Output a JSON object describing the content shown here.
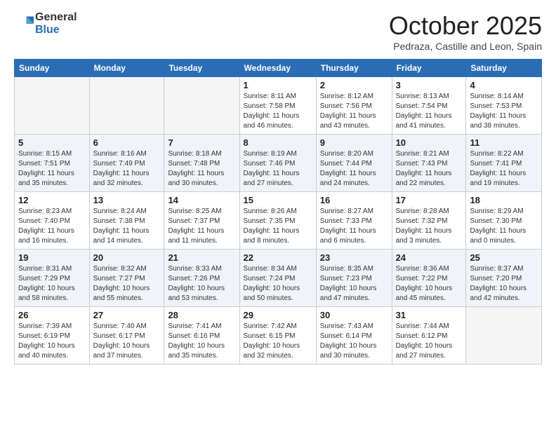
{
  "header": {
    "logo_general": "General",
    "logo_blue": "Blue",
    "month_title": "October 2025",
    "location": "Pedraza, Castille and Leon, Spain"
  },
  "days_of_week": [
    "Sunday",
    "Monday",
    "Tuesday",
    "Wednesday",
    "Thursday",
    "Friday",
    "Saturday"
  ],
  "weeks": [
    [
      {
        "day": "",
        "info": ""
      },
      {
        "day": "",
        "info": ""
      },
      {
        "day": "",
        "info": ""
      },
      {
        "day": "1",
        "info": "Sunrise: 8:11 AM\nSunset: 7:58 PM\nDaylight: 11 hours\nand 46 minutes."
      },
      {
        "day": "2",
        "info": "Sunrise: 8:12 AM\nSunset: 7:56 PM\nDaylight: 11 hours\nand 43 minutes."
      },
      {
        "day": "3",
        "info": "Sunrise: 8:13 AM\nSunset: 7:54 PM\nDaylight: 11 hours\nand 41 minutes."
      },
      {
        "day": "4",
        "info": "Sunrise: 8:14 AM\nSunset: 7:53 PM\nDaylight: 11 hours\nand 38 minutes."
      }
    ],
    [
      {
        "day": "5",
        "info": "Sunrise: 8:15 AM\nSunset: 7:51 PM\nDaylight: 11 hours\nand 35 minutes."
      },
      {
        "day": "6",
        "info": "Sunrise: 8:16 AM\nSunset: 7:49 PM\nDaylight: 11 hours\nand 32 minutes."
      },
      {
        "day": "7",
        "info": "Sunrise: 8:18 AM\nSunset: 7:48 PM\nDaylight: 11 hours\nand 30 minutes."
      },
      {
        "day": "8",
        "info": "Sunrise: 8:19 AM\nSunset: 7:46 PM\nDaylight: 11 hours\nand 27 minutes."
      },
      {
        "day": "9",
        "info": "Sunrise: 8:20 AM\nSunset: 7:44 PM\nDaylight: 11 hours\nand 24 minutes."
      },
      {
        "day": "10",
        "info": "Sunrise: 8:21 AM\nSunset: 7:43 PM\nDaylight: 11 hours\nand 22 minutes."
      },
      {
        "day": "11",
        "info": "Sunrise: 8:22 AM\nSunset: 7:41 PM\nDaylight: 11 hours\nand 19 minutes."
      }
    ],
    [
      {
        "day": "12",
        "info": "Sunrise: 8:23 AM\nSunset: 7:40 PM\nDaylight: 11 hours\nand 16 minutes."
      },
      {
        "day": "13",
        "info": "Sunrise: 8:24 AM\nSunset: 7:38 PM\nDaylight: 11 hours\nand 14 minutes."
      },
      {
        "day": "14",
        "info": "Sunrise: 8:25 AM\nSunset: 7:37 PM\nDaylight: 11 hours\nand 11 minutes."
      },
      {
        "day": "15",
        "info": "Sunrise: 8:26 AM\nSunset: 7:35 PM\nDaylight: 11 hours\nand 8 minutes."
      },
      {
        "day": "16",
        "info": "Sunrise: 8:27 AM\nSunset: 7:33 PM\nDaylight: 11 hours\nand 6 minutes."
      },
      {
        "day": "17",
        "info": "Sunrise: 8:28 AM\nSunset: 7:32 PM\nDaylight: 11 hours\nand 3 minutes."
      },
      {
        "day": "18",
        "info": "Sunrise: 8:29 AM\nSunset: 7:30 PM\nDaylight: 11 hours\nand 0 minutes."
      }
    ],
    [
      {
        "day": "19",
        "info": "Sunrise: 8:31 AM\nSunset: 7:29 PM\nDaylight: 10 hours\nand 58 minutes."
      },
      {
        "day": "20",
        "info": "Sunrise: 8:32 AM\nSunset: 7:27 PM\nDaylight: 10 hours\nand 55 minutes."
      },
      {
        "day": "21",
        "info": "Sunrise: 8:33 AM\nSunset: 7:26 PM\nDaylight: 10 hours\nand 53 minutes."
      },
      {
        "day": "22",
        "info": "Sunrise: 8:34 AM\nSunset: 7:24 PM\nDaylight: 10 hours\nand 50 minutes."
      },
      {
        "day": "23",
        "info": "Sunrise: 8:35 AM\nSunset: 7:23 PM\nDaylight: 10 hours\nand 47 minutes."
      },
      {
        "day": "24",
        "info": "Sunrise: 8:36 AM\nSunset: 7:22 PM\nDaylight: 10 hours\nand 45 minutes."
      },
      {
        "day": "25",
        "info": "Sunrise: 8:37 AM\nSunset: 7:20 PM\nDaylight: 10 hours\nand 42 minutes."
      }
    ],
    [
      {
        "day": "26",
        "info": "Sunrise: 7:39 AM\nSunset: 6:19 PM\nDaylight: 10 hours\nand 40 minutes."
      },
      {
        "day": "27",
        "info": "Sunrise: 7:40 AM\nSunset: 6:17 PM\nDaylight: 10 hours\nand 37 minutes."
      },
      {
        "day": "28",
        "info": "Sunrise: 7:41 AM\nSunset: 6:16 PM\nDaylight: 10 hours\nand 35 minutes."
      },
      {
        "day": "29",
        "info": "Sunrise: 7:42 AM\nSunset: 6:15 PM\nDaylight: 10 hours\nand 32 minutes."
      },
      {
        "day": "30",
        "info": "Sunrise: 7:43 AM\nSunset: 6:14 PM\nDaylight: 10 hours\nand 30 minutes."
      },
      {
        "day": "31",
        "info": "Sunrise: 7:44 AM\nSunset: 6:12 PM\nDaylight: 10 hours\nand 27 minutes."
      },
      {
        "day": "",
        "info": ""
      }
    ]
  ],
  "shaded_rows": [
    1,
    3
  ]
}
